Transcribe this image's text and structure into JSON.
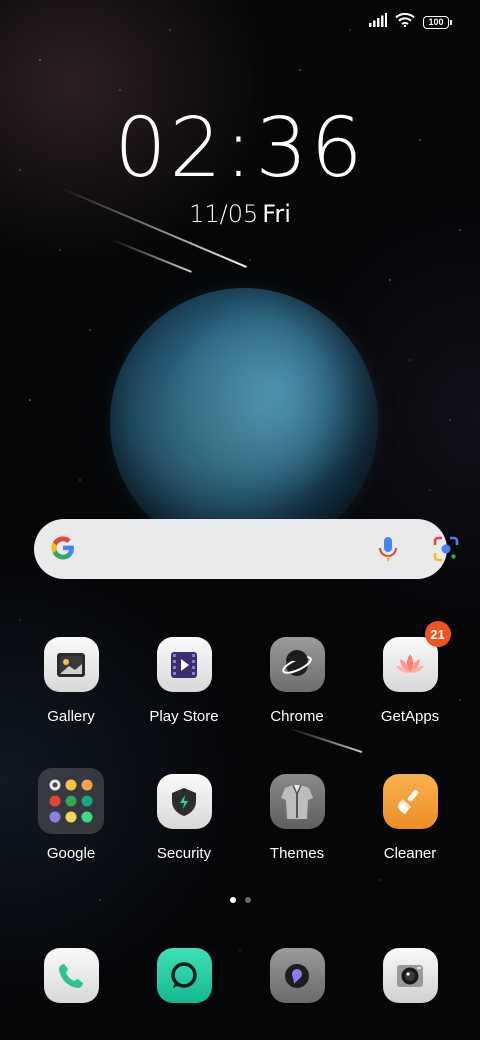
{
  "status_bar": {
    "battery": "100",
    "icons": [
      "signal-icon",
      "wifi-icon",
      "battery-icon"
    ]
  },
  "lockscreen": {
    "time": "02:36",
    "date": "11/05",
    "day": "Fri"
  },
  "search": {
    "icons": [
      "google-g-icon",
      "microphone-icon",
      "google-lens-icon"
    ]
  },
  "apps_row1": [
    {
      "label": "Gallery"
    },
    {
      "label": "Play Store"
    },
    {
      "label": "Chrome"
    },
    {
      "label": "GetApps",
      "badge": "21"
    }
  ],
  "apps_row2": [
    {
      "label": "Google"
    },
    {
      "label": "Security"
    },
    {
      "label": "Themes"
    },
    {
      "label": "Cleaner"
    }
  ],
  "page_indicator": {
    "pages": 2,
    "active": 1
  },
  "dock": {
    "icons": [
      "phone-icon",
      "messages-icon",
      "browser-icon",
      "camera-icon"
    ]
  },
  "colors": {
    "badge": "#f0541e",
    "cleaner": "#f39a36",
    "messages": "#22c8a0"
  }
}
